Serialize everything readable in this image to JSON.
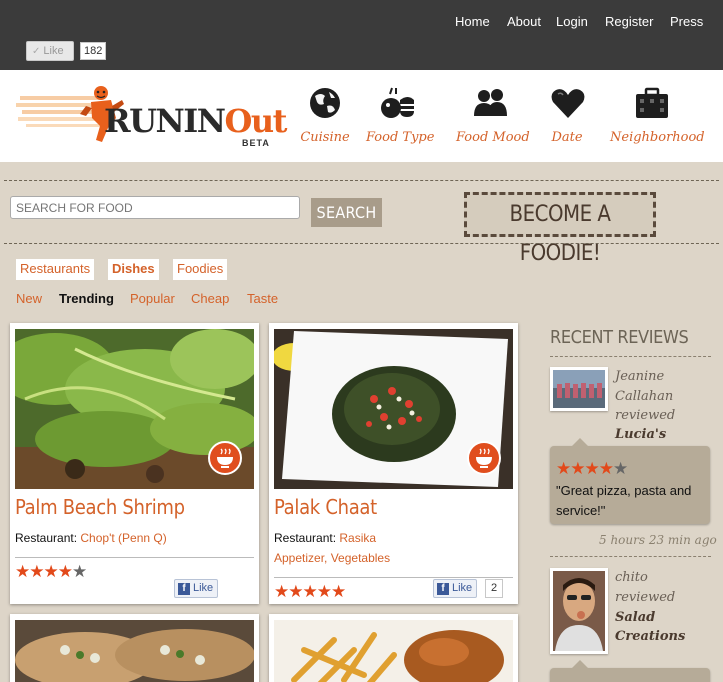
{
  "top_nav": {
    "links": [
      "Home",
      "About",
      "Login",
      "Register",
      "Press"
    ],
    "like_label": "Like",
    "like_count": "182"
  },
  "header": {
    "logo_text": "RUNINOut",
    "logo_badge": "BETA",
    "nav": [
      {
        "label": "Cuisine",
        "icon": "globe-icon"
      },
      {
        "label": "Food Type",
        "icon": "food-type-icon"
      },
      {
        "label": "Food Mood",
        "icon": "people-icon"
      },
      {
        "label": "Date",
        "icon": "heart-icon"
      },
      {
        "label": "Neighborhood",
        "icon": "city-icon"
      }
    ]
  },
  "search": {
    "placeholder": "SEARCH FOR FOOD",
    "button": "SEARCH",
    "foodie_button": "BECOME A FOODIE!"
  },
  "categories": [
    "Restaurants",
    "Dishes",
    "Foodies"
  ],
  "active_category": "Dishes",
  "sort_tabs": [
    "New",
    "Trending",
    "Popular",
    "Cheap",
    "Taste"
  ],
  "active_sort": "Trending",
  "dishes": [
    {
      "title": "Palm Beach Shrimp",
      "restaurant_label": "Restaurant:",
      "restaurant": "Chop't (Penn Q)",
      "tags": [],
      "rating": 4,
      "like_label": "Like",
      "like_count": ""
    },
    {
      "title": "Palak Chaat",
      "restaurant_label": "Restaurant:",
      "restaurant": "Rasika",
      "tags": [
        "Appetizer",
        "Vegetables"
      ],
      "tag_separator": ", ",
      "rating": 5,
      "like_label": "Like",
      "like_count": "2"
    }
  ],
  "recent_reviews": {
    "heading": "RECENT REVIEWS",
    "items": [
      {
        "reviewer_lines": [
          "Jeanine",
          "Callahan",
          "reviewed"
        ],
        "place": "Lucia's",
        "rating": 4,
        "quote": "\"Great pizza, pasta and service!\"",
        "time": "5 hours 23 min ago"
      },
      {
        "reviewer_lines": [
          "chito",
          "reviewed"
        ],
        "place": "Salad Creations"
      }
    ]
  },
  "colors": {
    "accent": "#d4622a",
    "star_on": "#e2491a",
    "top_bar": "#3b3b3b",
    "background": "#ddd5c8"
  }
}
